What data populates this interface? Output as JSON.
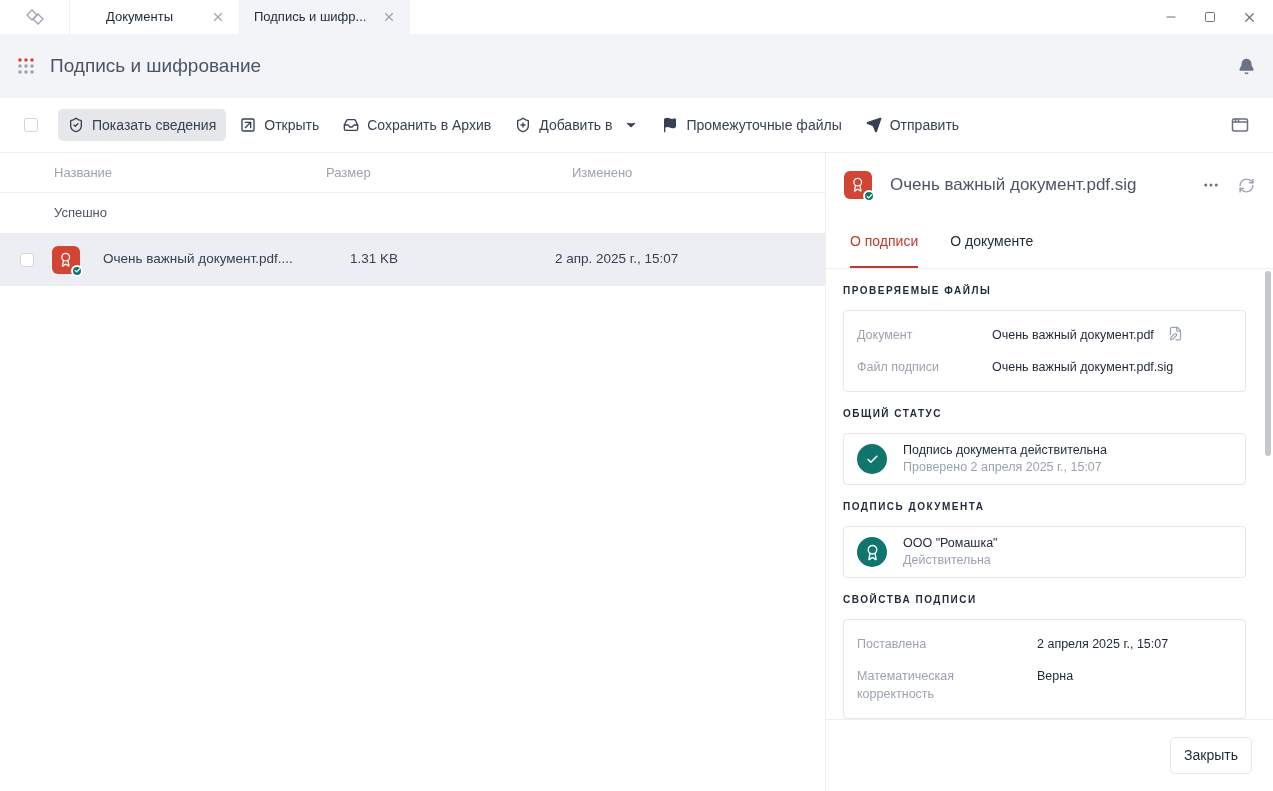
{
  "tabs": [
    {
      "label": "Документы",
      "selected": false
    },
    {
      "label": "Подпись и шифр...",
      "selected": true
    }
  ],
  "header": {
    "title": "Подпись и шифрование"
  },
  "toolbar": {
    "select_all": {
      "checked": false
    },
    "items": [
      {
        "label": "Показать сведения",
        "kind": "button",
        "selected": true
      },
      {
        "label": "Открыть",
        "kind": "button",
        "selected": false
      },
      {
        "label": "Сохранить в Архив",
        "kind": "button",
        "selected": false
      },
      {
        "label": "Добавить в",
        "kind": "menu",
        "selected": false
      },
      {
        "label": "Промежуточные файлы",
        "kind": "button",
        "selected": false
      },
      {
        "label": "Отправить",
        "kind": "button",
        "selected": false
      }
    ]
  },
  "table": {
    "columns": [
      "Название",
      "Размер",
      "Изменено"
    ],
    "group": "Успешно",
    "rows": [
      {
        "name": "Очень важный документ.pdf....",
        "size": "1.31 KB",
        "modified": "2 апр. 2025 г., 15:07",
        "selected": true,
        "checked": false
      }
    ]
  },
  "details": {
    "title": "Очень важный документ.pdf.sig",
    "tabs": [
      {
        "label": "О подписи",
        "selected": true
      },
      {
        "label": "О документе",
        "selected": false
      }
    ],
    "sections": [
      {
        "heading": "ПРОВЕРЯЕМЫЕ ФАЙЛЫ",
        "kind": "fields",
        "rows": [
          {
            "label": "Документ",
            "value": "Очень важный документ.pdf"
          },
          {
            "label": "Файл подписи",
            "value": "Очень важный документ.pdf.sig"
          }
        ]
      },
      {
        "heading": "ОБЩИЙ СТАТУС",
        "kind": "status",
        "title": "Подпись документа действительна",
        "subtitle": "Проверено 2 апреля 2025 г., 15:07"
      },
      {
        "heading": "ПОДПИСЬ ДОКУМЕНТА",
        "kind": "signer",
        "title": "ООО \"Ромашка\"",
        "subtitle": "Действительна"
      },
      {
        "heading": "СВОЙСТВА ПОДПИСИ",
        "kind": "fields",
        "rows": [
          {
            "label": "Поставлена",
            "value": "2 апреля 2025 г., 15:07"
          },
          {
            "label": "Математическая корректность",
            "value": "Верна"
          }
        ]
      }
    ],
    "close": "Закрыть"
  }
}
